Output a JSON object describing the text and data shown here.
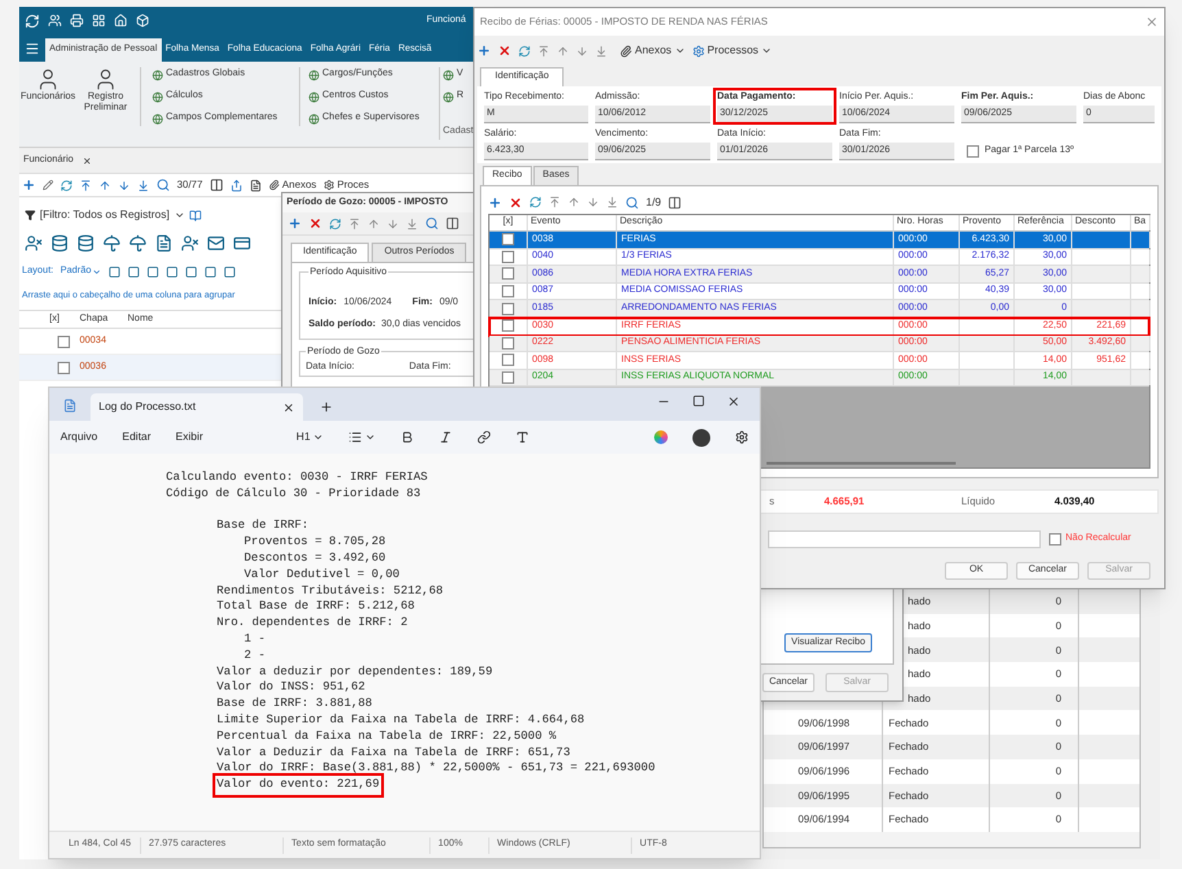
{
  "app": {
    "header_title": "Funcioná",
    "menu_tabs": [
      {
        "label": "Administração de Pessoal",
        "selected": true
      },
      {
        "label": "Folha Mensa",
        "selected": false
      },
      {
        "label": "Folha Educaciona",
        "selected": false
      },
      {
        "label": "Folha Agrári",
        "selected": false
      },
      {
        "label": "Féria",
        "selected": false
      },
      {
        "label": "Rescisã",
        "selected": false
      }
    ],
    "ribbon": {
      "big_buttons": [
        "Funcionários",
        "Registro Preliminar"
      ],
      "groups": [
        [
          "Cadastros Globais",
          "Cálculos",
          "Campos Complementares"
        ],
        [
          "Cargos/Funções",
          "Centros Custos",
          "Chefes e Supervisores"
        ],
        [
          "V",
          "R"
        ]
      ],
      "section_label": "Cadast"
    },
    "doc_tab": "Funcionário",
    "toolbar": {
      "position": "30/77",
      "attachments": "Anexos",
      "processes": "Proces"
    },
    "filter": "[Filtro: Todos os Registros]",
    "layout_label": "Layout:",
    "layout_value": "Padrão",
    "group_hint": "Arraste aqui o cabeçalho de uma coluna para agrupar",
    "grid": {
      "columns": [
        "[x]",
        "Chapa",
        "Nome"
      ],
      "rows": [
        {
          "chapa": "00034",
          "checked": false
        },
        {
          "chapa": "00036",
          "checked": false
        }
      ]
    },
    "history_table": {
      "rows": [
        {
          "status": "hado",
          "value": "0"
        },
        {
          "status": "hado",
          "value": "0"
        },
        {
          "status": "hado",
          "value": "0"
        },
        {
          "status": "hado",
          "value": "0"
        },
        {
          "status": "hado",
          "value": "0"
        },
        {
          "date": "09/06/1998",
          "status": "Fechado",
          "value": "0"
        },
        {
          "date": "09/06/1997",
          "status": "Fechado",
          "value": "0"
        },
        {
          "date": "09/06/1996",
          "status": "Fechado",
          "value": "0"
        },
        {
          "date": "09/06/1995",
          "status": "Fechado",
          "value": "0"
        },
        {
          "date": "09/06/1994",
          "status": "Fechado",
          "value": "0"
        }
      ]
    }
  },
  "period_window": {
    "title": "Período de Gozo: 00005 - IMPOSTO",
    "tabs": [
      {
        "label": "Identificação",
        "selected": true
      },
      {
        "label": "Outros Períodos",
        "selected": false
      }
    ],
    "acquisition": {
      "legend": "Período Aquisitivo",
      "start_label": "Início:",
      "start": "10/06/2024",
      "end_label": "Fim:",
      "end": "09/0",
      "balance_label": "Saldo período:",
      "balance": "30,0 dias vencidos"
    },
    "enjoyment": {
      "legend": "Período de Gozo",
      "start_label": "Data Início:",
      "end_label": "Data Fim:"
    },
    "view_button": "Visualizar Recibo",
    "buttons": [
      {
        "label": "Cancelar",
        "disabled": false
      },
      {
        "label": "Salvar",
        "disabled": true
      }
    ]
  },
  "receipt_window": {
    "title": "Recibo de Férias: 00005 - IMPOSTO DE RENDA NAS FÉRIAS",
    "toolbar": {
      "attachments": "Anexos",
      "processes": "Processos"
    },
    "tab": "Identificação",
    "fields_row1": [
      {
        "label": "Tipo Recebimento:",
        "value": "M",
        "bold": false,
        "highlighted": false
      },
      {
        "label": "Admissão:",
        "value": "10/06/2012",
        "bold": false,
        "highlighted": false
      },
      {
        "label": "Data Pagamento:",
        "value": "30/12/2025",
        "bold": true,
        "highlighted": true
      },
      {
        "label": "Início Per. Aquis.:",
        "value": "10/06/2024",
        "bold": false,
        "highlighted": false
      },
      {
        "label": "Fim Per. Aquis.:",
        "value": "09/06/2025",
        "bold": true,
        "highlighted": false
      },
      {
        "label": "Dias de Abonc",
        "value": "0",
        "bold": false,
        "highlighted": false
      }
    ],
    "fields_row2": [
      {
        "label": "Salário:",
        "value": "6.423,30",
        "bold": false,
        "highlighted": false
      },
      {
        "label": "Vencimento:",
        "value": "09/06/2025",
        "bold": false,
        "highlighted": false
      },
      {
        "label": "Data Início:",
        "value": "01/01/2026",
        "bold": false,
        "highlighted": false
      },
      {
        "label": "Data Fim:",
        "value": "30/01/2026",
        "bold": false,
        "highlighted": false
      }
    ],
    "first_installment": {
      "label": "Pagar 1ª Parcela 13º",
      "checked": false
    },
    "sub_tabs": [
      {
        "label": "Recibo",
        "selected": true
      },
      {
        "label": "Bases",
        "selected": false
      }
    ],
    "grid_position": "1/9",
    "columns": [
      "[x]",
      "Evento",
      "Descrição",
      "Nro. Horas",
      "Provento",
      "Referência",
      "Desconto",
      "Ba"
    ],
    "rows": [
      {
        "checked": false,
        "selected": true,
        "highlighted": false,
        "event": "0038",
        "description": "FERIAS",
        "hours": "000:00",
        "earning": "6.423,30",
        "reference": "30,00",
        "deduction": ""
      },
      {
        "checked": false,
        "selected": false,
        "highlighted": false,
        "color": "#2a2ad0",
        "event": "0040",
        "description": "1/3 FERIAS",
        "hours": "000:00",
        "earning": "2.176,32",
        "reference": "30,00",
        "deduction": ""
      },
      {
        "checked": false,
        "selected": false,
        "highlighted": false,
        "color": "#2a2ad0",
        "event": "0086",
        "description": "MEDIA HORA EXTRA FERIAS",
        "hours": "000:00",
        "earning": "65,27",
        "reference": "30,00",
        "deduction": ""
      },
      {
        "checked": false,
        "selected": false,
        "highlighted": false,
        "color": "#2a2ad0",
        "event": "0087",
        "description": "MEDIA COMISSAO FERIAS",
        "hours": "000:00",
        "earning": "40,39",
        "reference": "30,00",
        "deduction": ""
      },
      {
        "checked": false,
        "selected": false,
        "highlighted": false,
        "color": "#2a2ad0",
        "event": "0185",
        "description": "ARREDONDAMENTO NAS FERIAS",
        "hours": "000:00",
        "earning": "0,00",
        "reference": "0",
        "deduction": ""
      },
      {
        "checked": false,
        "selected": false,
        "highlighted": true,
        "color": "#ee2a2a",
        "event": "0030",
        "description": "IRRF FERIAS",
        "hours": "000:00",
        "earning": "",
        "reference": "22,50",
        "deduction": "221,69"
      },
      {
        "checked": false,
        "selected": false,
        "highlighted": false,
        "color": "#ee2a2a",
        "event": "0222",
        "description": "PENSAO ALIMENTICIA FERIAS",
        "hours": "000:00",
        "earning": "",
        "reference": "50,00",
        "deduction": "3.492,60"
      },
      {
        "checked": false,
        "selected": false,
        "highlighted": false,
        "color": "#ee2a2a",
        "event": "0098",
        "description": "INSS FERIAS",
        "hours": "000:00",
        "earning": "",
        "reference": "14,00",
        "deduction": "951,62"
      },
      {
        "checked": false,
        "selected": false,
        "highlighted": false,
        "color": "#1c9a1c",
        "event": "0204",
        "description": "INSS FERIAS ALIQUOTA NORMAL",
        "hours": "000:00",
        "earning": "",
        "reference": "14,00",
        "deduction": ""
      }
    ],
    "totals": {
      "cut_label": "s",
      "deductions": "4.665,91",
      "net_label": "Líquido",
      "net": "4.039,40"
    },
    "no_recalc": {
      "label": "Não Recalcular",
      "checked": false
    },
    "buttons": [
      {
        "label": "OK",
        "disabled": false
      },
      {
        "label": "Cancelar",
        "disabled": false
      },
      {
        "label": "Salvar",
        "disabled": true
      }
    ]
  },
  "notepad": {
    "tab_title": "Log do Processo.txt",
    "menu": [
      "Arquivo",
      "Editar",
      "Exibir"
    ],
    "heading": "H1",
    "lines": [
      {
        "text": "Calculando evento: 0030 - IRRF FERIAS",
        "highlighted": false
      },
      {
        "text": "Código de Cálculo 30 - Prioridade 83",
        "highlighted": false,
        "children": [
          {
            "text": "Base de IRRF:",
            "highlighted": false,
            "children": [
              {
                "text": "Proventos = 8.705,28",
                "highlighted": false
              },
              {
                "text": "Descontos = 3.492,60",
                "highlighted": false
              },
              {
                "text": "Valor Dedutivel = 0,00",
                "highlighted": false
              }
            ]
          },
          {
            "text": "Rendimentos Tributáveis: 5212,68",
            "highlighted": false
          },
          {
            "text": "Total Base de IRRF: 5.212,68",
            "highlighted": false
          },
          {
            "text": "Nro. dependentes de IRRF: 2",
            "highlighted": false,
            "children": [
              {
                "text": "1 -",
                "highlighted": false
              },
              {
                "text": "2 -",
                "highlighted": false
              }
            ]
          },
          {
            "text": "Valor a deduzir por dependentes: 189,59",
            "highlighted": false
          },
          {
            "text": "Valor do INSS: 951,62",
            "highlighted": false
          },
          {
            "text": "Base de IRRF: 3.881,88",
            "highlighted": false
          },
          {
            "text": "Limite Superior da Faixa na Tabela de IRRF: 4.664,68",
            "highlighted": false
          },
          {
            "text": "Percentual da Faixa na Tabela de IRRF: 22,5000 %",
            "highlighted": false
          },
          {
            "text": "Valor a Deduzir da Faixa na Tabela de IRRF: 651,73",
            "highlighted": false
          },
          {
            "text": "Valor do IRRF: Base(3.881,88) * 22,5000% - 651,73 = 221,693000",
            "highlighted": false
          },
          {
            "text": "Valor do evento: 221,69",
            "highlighted": true
          }
        ]
      }
    ],
    "status_bar": [
      "Ln 484, Col 45",
      "27.975 caracteres",
      "Texto sem formatação",
      "100%",
      "Windows (CRLF)",
      "UTF-8"
    ]
  }
}
